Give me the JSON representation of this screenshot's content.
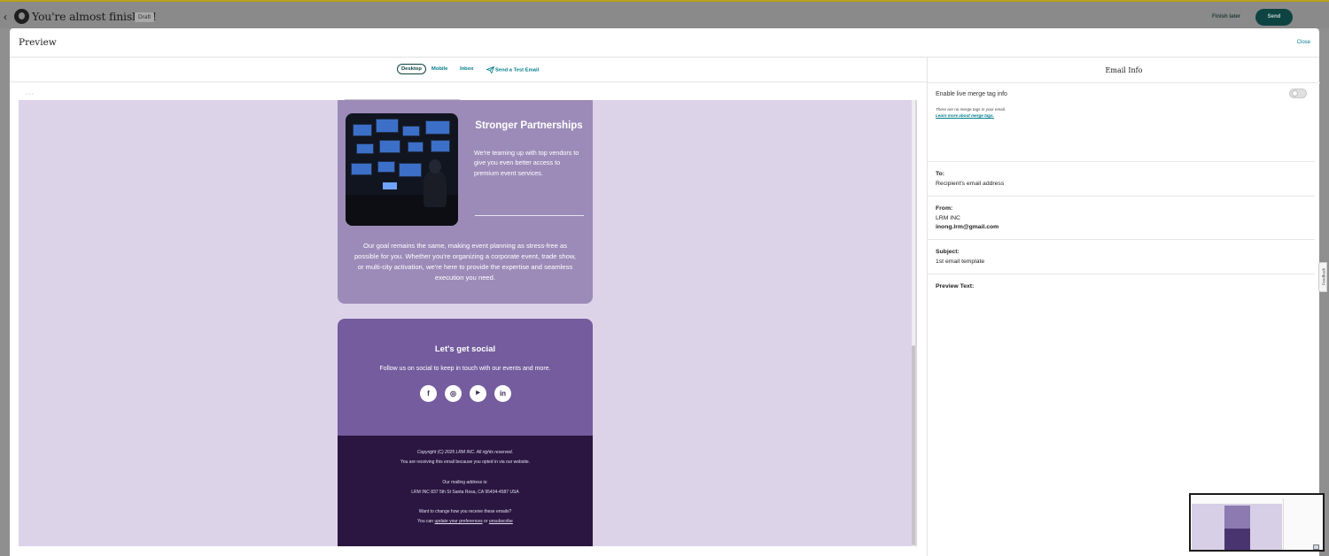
{
  "header": {
    "back_label": "‹",
    "title": "You're almost finished!",
    "status_badge": "Draft",
    "finish_later": "Finish later",
    "send": "Send"
  },
  "modal": {
    "title": "Preview",
    "close": "Close"
  },
  "preview_tabs": [
    {
      "label": "Desktop",
      "active": true
    },
    {
      "label": "Mobile",
      "active": false
    },
    {
      "label": "Inbox",
      "active": false
    },
    {
      "label": "Send a Test Email",
      "icon": "paper-plane-icon",
      "active": false
    }
  ],
  "email": {
    "dots": "···",
    "feature": {
      "title": "Stronger Partnerships",
      "body": "We're teaming up with top vendors to give you even better access to premium event services."
    },
    "goal_text": "Our goal remains the same, making event planning as stress-free as possible for you. Whether you're organizing a corporate event, trade show, or multi-city activation, we're here to provide the expertise and seamless execution you need.",
    "social": {
      "title": "Let's get social",
      "body": "Follow us on social to keep in touch with our events and more.",
      "icons": [
        {
          "name": "facebook-icon",
          "glyph": "f"
        },
        {
          "name": "instagram-icon",
          "glyph": "◎"
        },
        {
          "name": "youtube-icon",
          "glyph": "▶"
        },
        {
          "name": "linkedin-icon",
          "glyph": "in"
        }
      ]
    },
    "footer": {
      "copyright": "Copyright (C) 2025 LRM INC. All rights reserved.",
      "opt_in": "You are receiving this email because you opted in via our website.",
      "mailing_label": "Our mailing address is:",
      "address": "LRM INC 837 5th St Santa Rosa, CA 95404-4587 USA",
      "change_prompt": "Want to change how you receive these emails?",
      "you_can": "You can",
      "update_link": "update your preferences",
      "or": "or",
      "unsubscribe_link": "unsubscribe"
    }
  },
  "info": {
    "title": "Email Info",
    "merge_label": "Enable live merge tag info",
    "merge_enabled": false,
    "merge_note": "There are no merge tags in your email.",
    "merge_link": "Learn more about merge tags.",
    "to_label": "To:",
    "to_value": "Recipient's email address",
    "from_label": "From:",
    "from_name": "LRM INC",
    "from_email": "inong.lrm@gmail.com",
    "subject_label": "Subject:",
    "subject_value": "1st email template",
    "preview_label": "Preview Text:"
  },
  "feedback_label": "Feedback",
  "colors": {
    "brand_dark": "#0d4442",
    "link": "#007c89",
    "email_card": "#9c8bb8",
    "email_social": "#745c9e",
    "email_footer": "#2a1640"
  }
}
